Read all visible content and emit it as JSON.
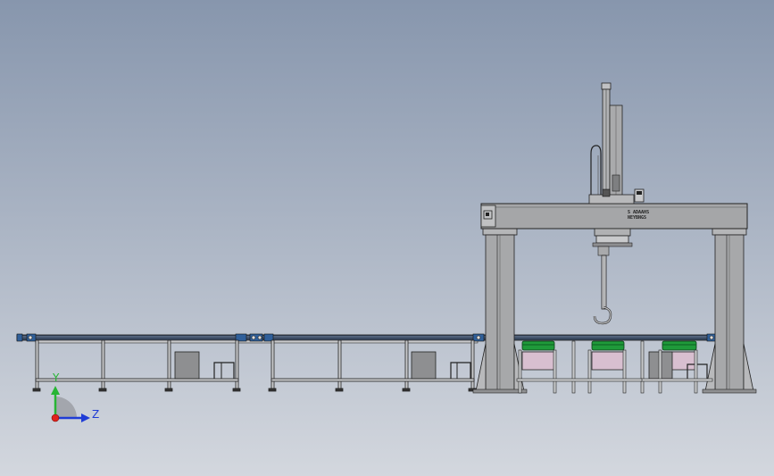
{
  "canvas": {
    "background_top": "#8796ad",
    "background_bottom": "#d3d7de"
  },
  "colors": {
    "steel": "#a3a4a6",
    "steel_dark": "#6e6f72",
    "outline": "#2a2a2a",
    "rail": "#2f3f55",
    "belt_green": "#1f9a3a",
    "belt_green_dark": "#0b5e22",
    "tray_pink": "#d8bfd0",
    "box_gray": "#8e8f91",
    "axis_x": "#e0231c",
    "axis_y": "#27b534",
    "axis_z": "#1f3cd6"
  },
  "nameplate": {
    "line1": "S ADAAHS",
    "line2": "NEYBNGS"
  },
  "triad": {
    "y_label": "Y",
    "z_label": "Z",
    "x_icon": "x-axis-arrow",
    "y_icon": "y-axis-arrow",
    "z_icon": "z-axis-arrow"
  }
}
